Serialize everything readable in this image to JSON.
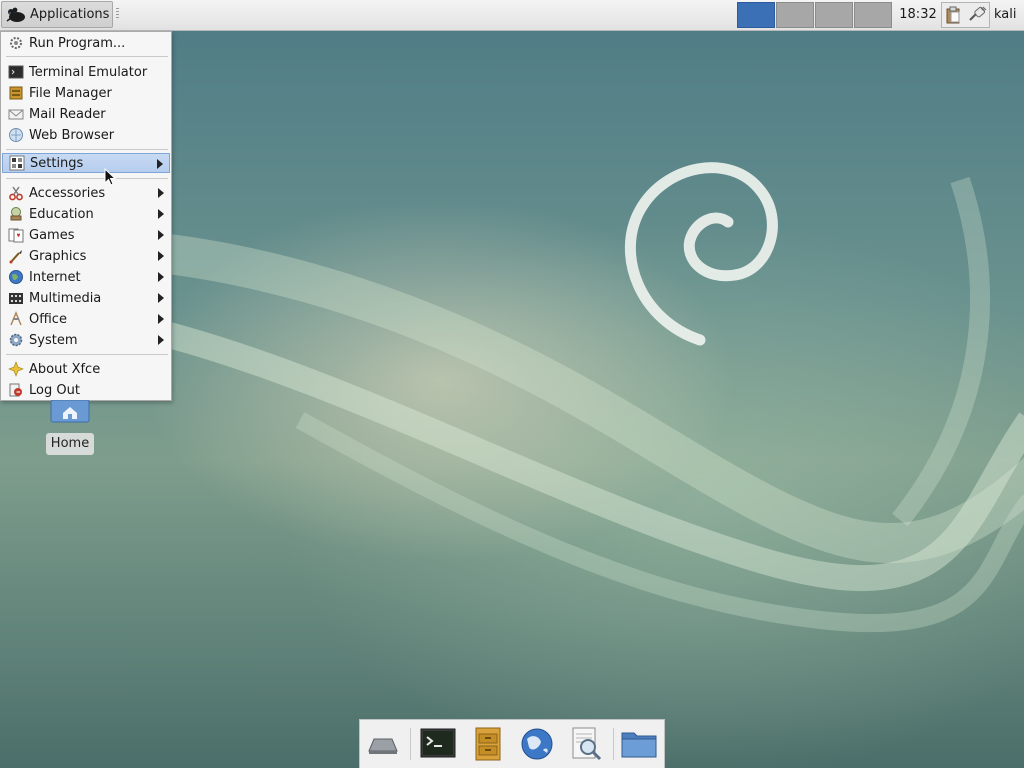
{
  "panel": {
    "applications_label": "Applications",
    "clock": "18:32",
    "user": "kali",
    "workspaces": [
      {
        "active": true
      },
      {
        "active": false
      },
      {
        "active": false
      },
      {
        "active": false
      }
    ]
  },
  "menu": {
    "items": [
      {
        "label": "Run Program...",
        "icon": "run-program-icon",
        "submenu": false
      },
      {
        "label": "Terminal Emulator",
        "icon": "terminal-icon",
        "submenu": false
      },
      {
        "label": "File Manager",
        "icon": "file-manager-icon",
        "submenu": false
      },
      {
        "label": "Mail Reader",
        "icon": "mail-icon",
        "submenu": false
      },
      {
        "label": "Web Browser",
        "icon": "web-browser-icon",
        "submenu": false
      },
      {
        "label": "Settings",
        "icon": "settings-icon",
        "submenu": true,
        "highlighted": true
      },
      {
        "label": "Accessories",
        "icon": "accessories-icon",
        "submenu": true
      },
      {
        "label": "Education",
        "icon": "education-icon",
        "submenu": true
      },
      {
        "label": "Games",
        "icon": "games-icon",
        "submenu": true
      },
      {
        "label": "Graphics",
        "icon": "graphics-icon",
        "submenu": true
      },
      {
        "label": "Internet",
        "icon": "internet-icon",
        "submenu": true
      },
      {
        "label": "Multimedia",
        "icon": "multimedia-icon",
        "submenu": true
      },
      {
        "label": "Office",
        "icon": "office-icon",
        "submenu": true
      },
      {
        "label": "System",
        "icon": "system-icon",
        "submenu": true
      },
      {
        "label": "About Xfce",
        "icon": "about-xfce-icon",
        "submenu": false
      },
      {
        "label": "Log Out",
        "icon": "log-out-icon",
        "submenu": false
      }
    ]
  },
  "desktop": {
    "home_label": "Home"
  },
  "dock": {
    "items": [
      {
        "icon": "show-desktop-icon"
      },
      {
        "icon": "terminal-icon"
      },
      {
        "icon": "file-manager-icon"
      },
      {
        "icon": "web-browser-icon"
      },
      {
        "icon": "app-finder-icon"
      },
      {
        "icon": "folder-icon"
      }
    ]
  },
  "colors": {
    "workspace_active": "#3b6fb6",
    "menu_highlight": "#b6cdee",
    "desktop_base": "#6a928e"
  }
}
